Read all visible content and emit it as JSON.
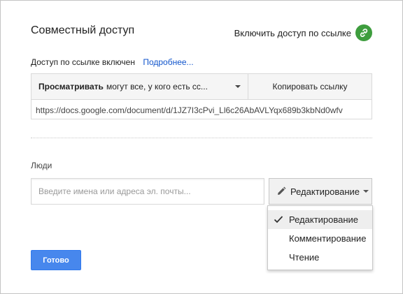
{
  "dialog": {
    "title": "Совместный доступ",
    "enable_link_label": "Включить доступ по ссылке"
  },
  "link_access": {
    "status": "Доступ по ссылке включен",
    "more_link": "Подробнее..."
  },
  "share": {
    "permission_bold": "Просматривать",
    "permission_rest": "могут все, у кого есть сс...",
    "copy_label": "Копировать ссылку",
    "url": "https://docs.google.com/document/d/1JZ7I3cPvi_Ll6c26AbAVLYqx689b3kbNd0wfv"
  },
  "people": {
    "label": "Люди",
    "placeholder": "Введите имена или адреса эл. почты...",
    "mode_label": "Редактирование"
  },
  "menu": {
    "items": [
      {
        "label": "Редактирование",
        "selected": true
      },
      {
        "label": "Комментирование",
        "selected": false
      },
      {
        "label": "Чтение",
        "selected": false
      }
    ]
  },
  "footer": {
    "done_label": "Готово"
  },
  "colors": {
    "link_icon_bg": "#3e9d3e",
    "primary_button": "#4787ed",
    "link_text": "#1155cc"
  }
}
